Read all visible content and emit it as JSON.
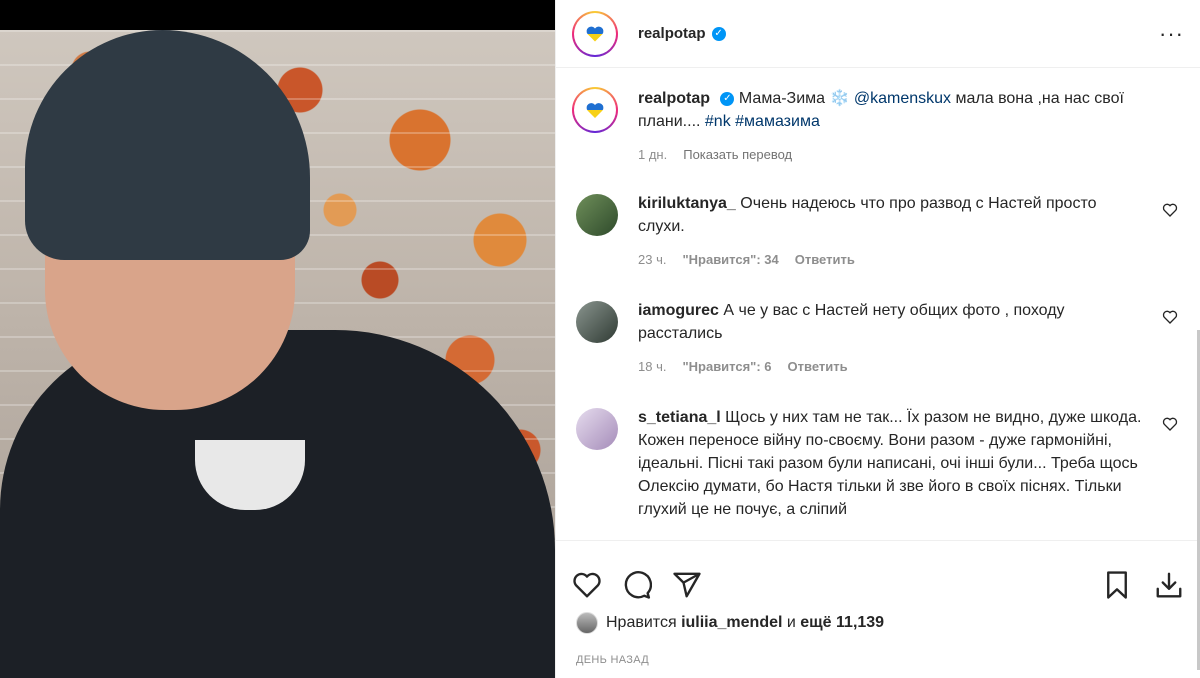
{
  "post": {
    "username": "realpotap",
    "verified_mark": "✓",
    "more_label": "···",
    "caption": {
      "text_main": "Мама-Зима ❄️ ",
      "mention": "@kamenskux",
      "text_rest": " мала вона ,на нас свої плани.... ",
      "hashtag1": "#nk",
      "hashtag2": "#мамазима",
      "time": "1 дн.",
      "translate": "Показать перевод"
    }
  },
  "comments": [
    {
      "username": "kiriluktanya_",
      "text": "Очень надеюсь что про развод с Настей просто слухи.",
      "time": "23 ч.",
      "likes": "\"Нравится\": 34",
      "reply": "Ответить",
      "avatar_color": "#4a6b3a"
    },
    {
      "username": "iamogurec",
      "text": "А че у вас с Настей нету общих фото , походу расстались",
      "time": "18 ч.",
      "likes": "\"Нравится\": 6",
      "reply": "Ответить",
      "avatar_color": "#3f4a44"
    },
    {
      "username": "s_tetiana_l",
      "text": "Щось у них там не так... Їх разом не видно, дуже шкода. Кожен переносе війну по-своєму. Вони разом - дуже гармонійні, ідеальні. Пісні такі разом були написані, очі інші були... Треба щось Олексію думати, бо Настя тільки й зве його в своїх піснях. Тільки глухий це не почує, а сліпий",
      "time": "",
      "likes": "",
      "reply": "",
      "avatar_color": "#c9b7d6"
    }
  ],
  "likes": {
    "prefix": "Нравится",
    "user": "iuliia_mendel",
    "middle": "и",
    "more": "ещё 11,139"
  },
  "date": "День назад",
  "icons": [
    "heart-icon",
    "comment-icon",
    "share-icon",
    "bookmark-icon",
    "download-icon"
  ],
  "colors": {
    "link": "#00376b",
    "verified": "#0095f6",
    "muted": "#8e8e8e"
  }
}
